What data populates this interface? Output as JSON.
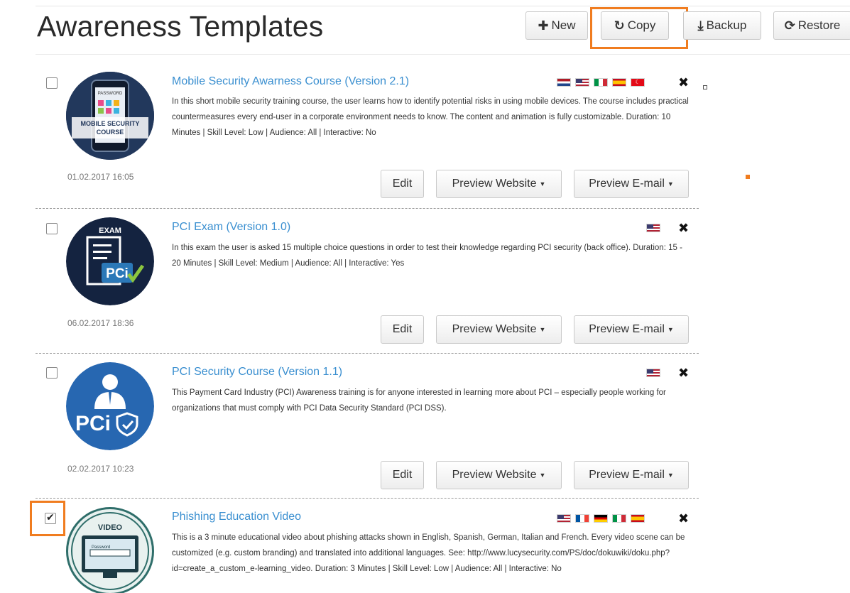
{
  "page": {
    "title": "Awareness Templates"
  },
  "toolbar": {
    "new_label": "New",
    "copy_label": "Copy",
    "backup_label": "Backup",
    "restore_label": "Restore"
  },
  "actions": {
    "edit": "Edit",
    "preview_website": "Preview Website",
    "preview_email": "Preview E-mail"
  },
  "thumb_text": {
    "mobile": "MOBILE SECURITY COURSE",
    "mobile_password": "PASSWORD",
    "exam_top": "EXAM",
    "exam_badge": "PCi",
    "pci_badge": "PCi",
    "video_top": "VIDEO",
    "video_screen": "Password"
  },
  "templates": [
    {
      "name": "Mobile Security Awarness Course (Version 2.1)",
      "description": "In this short mobile security training course, the user learns how to identify potential risks in using mobile devices. The course includes practical countermeasures every end-user in a corporate environment needs to know. The content and animation is fully customizable. Duration: 10 Minutes | Skill Level: Low | Audience: All | Interactive: No",
      "date": "01.02.2017 16:05",
      "checked": false,
      "flags": [
        "nl",
        "us",
        "it",
        "es",
        "tr"
      ]
    },
    {
      "name": "PCI Exam (Version 1.0)",
      "description": "In this exam the user is asked 15 multiple choice questions in order to test their knowledge regarding PCI security (back office). Duration: 15 - 20 Minutes | Skill Level: Medium | Audience: All | Interactive: Yes",
      "date": "06.02.2017 18:36",
      "checked": false,
      "flags": [
        "us"
      ]
    },
    {
      "name": "PCI Security Course (Version 1.1)",
      "description": "This Payment Card Industry (PCI) Awareness training is for anyone interested in learning more about PCI – especially people working for organizations that must comply with PCI Data Security Standard (PCI DSS).",
      "date": "02.02.2017 10:23",
      "checked": false,
      "flags": [
        "us"
      ]
    },
    {
      "name": "Phishing Education Video",
      "description": "This is a 3 minute educational video about phishing attacks shown in English, Spanish, German, Italian and French. Every video scene can be customized (e.g. custom branding) and translated into additional languages. See: http://www.lucysecurity.com/PS/doc/dokuwiki/doku.php?id=create_a_custom_e-learning_video. Duration: 3 Minutes | Skill Level: Low | Audience: All | Interactive: No",
      "checked": true,
      "flags": [
        "us",
        "fr",
        "de",
        "it",
        "es"
      ]
    }
  ],
  "colors": {
    "link": "#3a8fd0",
    "highlight": "#f07c1f",
    "thumb_dark": "#142340",
    "thumb_blue": "#2767b1"
  }
}
